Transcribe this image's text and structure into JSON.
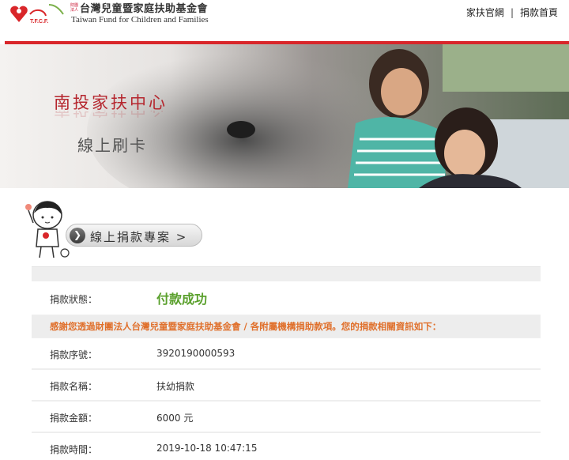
{
  "header": {
    "org_badge": "財團法人",
    "org_name": "台灣兒童暨家庭扶助基金會",
    "org_name_en": "Taiwan Fund for Children and Families",
    "logo_text": "T.F.C.F.",
    "links": [
      "家扶官網",
      "捐款首頁"
    ],
    "separator": "|"
  },
  "banner": {
    "title": "南投家扶中心",
    "subtitle": "線上刷卡"
  },
  "project_button": {
    "icon": "chevron-circle-icon",
    "arrow_glyph": "❯",
    "label": "線上捐款專案 >"
  },
  "result": {
    "status_label": "捐款狀態：",
    "status_value": "付款成功",
    "notice": "感謝您透過財團法人台灣兒童暨家庭扶助基金會 / 各附屬機構捐助款項。您的捐款相關資訊如下：",
    "rows": [
      {
        "label": "捐款序號：",
        "value": "3920190000593"
      },
      {
        "label": "捐款名稱：",
        "value": "扶幼捐款"
      },
      {
        "label": "捐款金額：",
        "value": "6000 元"
      },
      {
        "label": "捐款時間：",
        "value": "2019-10-18 10:47:15"
      }
    ]
  },
  "colors": {
    "brand_red": "#d9262a",
    "success_green": "#5aa02c",
    "notice_orange": "#e0702c"
  }
}
